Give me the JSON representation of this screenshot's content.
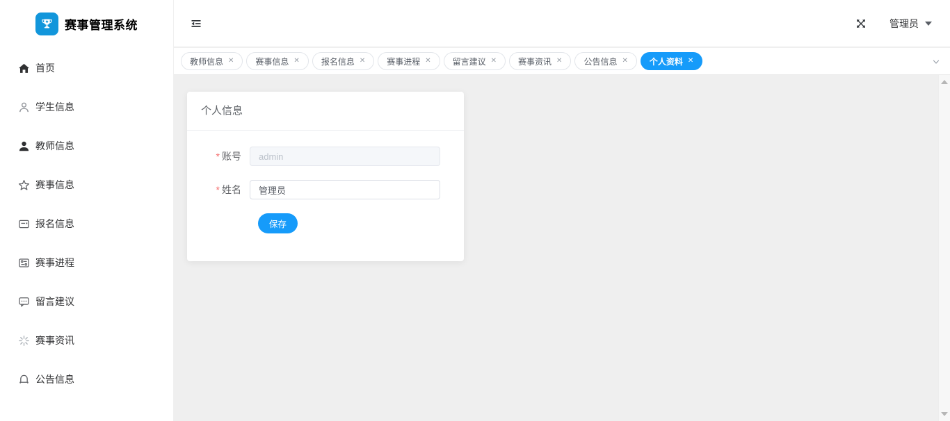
{
  "app": {
    "title": "赛事管理系统"
  },
  "topbar": {
    "username": "管理员"
  },
  "sidebar": {
    "items": [
      {
        "label": "首页",
        "icon": "home-icon"
      },
      {
        "label": "学生信息",
        "icon": "student-icon"
      },
      {
        "label": "教师信息",
        "icon": "teacher-icon"
      },
      {
        "label": "赛事信息",
        "icon": "star-icon"
      },
      {
        "label": "报名信息",
        "icon": "registration-icon"
      },
      {
        "label": "赛事进程",
        "icon": "progress-icon"
      },
      {
        "label": "留言建议",
        "icon": "message-icon"
      },
      {
        "label": "赛事资讯",
        "icon": "news-icon"
      },
      {
        "label": "公告信息",
        "icon": "bell-icon"
      }
    ]
  },
  "tabs": {
    "items": [
      {
        "label": "教师信息",
        "active": false
      },
      {
        "label": "赛事信息",
        "active": false
      },
      {
        "label": "报名信息",
        "active": false
      },
      {
        "label": "赛事进程",
        "active": false
      },
      {
        "label": "留言建议",
        "active": false
      },
      {
        "label": "赛事资讯",
        "active": false
      },
      {
        "label": "公告信息",
        "active": false
      },
      {
        "label": "个人资料",
        "active": true
      }
    ]
  },
  "profile_card": {
    "title": "个人信息",
    "required_marker": "*",
    "fields": [
      {
        "label": "账号",
        "value": "admin",
        "disabled": true
      },
      {
        "label": "姓名",
        "value": "管理员",
        "disabled": false
      }
    ],
    "save_label": "保存"
  },
  "colors": {
    "primary": "#169bfa",
    "logo_bg": "#1296db",
    "required": "#f56c6c",
    "content_bg": "#efefef"
  }
}
